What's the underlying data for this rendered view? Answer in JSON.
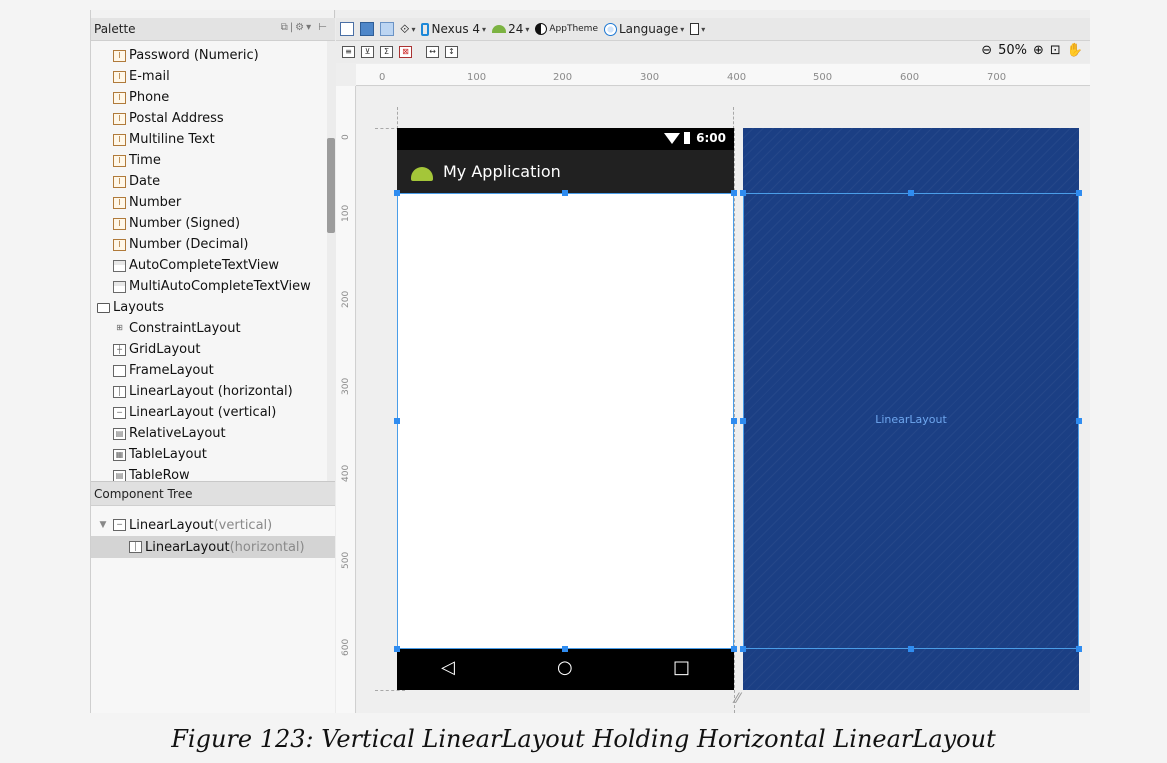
{
  "palette": {
    "title": "Palette",
    "items": [
      {
        "label": "Password (Numeric)",
        "icon": "text-field-icon"
      },
      {
        "label": "E-mail",
        "icon": "text-field-icon"
      },
      {
        "label": "Phone",
        "icon": "text-field-icon"
      },
      {
        "label": "Postal Address",
        "icon": "text-field-icon"
      },
      {
        "label": "Multiline Text",
        "icon": "text-field-icon"
      },
      {
        "label": "Time",
        "icon": "text-field-icon"
      },
      {
        "label": "Date",
        "icon": "text-field-icon"
      },
      {
        "label": "Number",
        "icon": "text-field-icon"
      },
      {
        "label": "Number (Signed)",
        "icon": "text-field-icon"
      },
      {
        "label": "Number (Decimal)",
        "icon": "text-field-icon"
      },
      {
        "label": "AutoCompleteTextView",
        "icon": "autocomplete-icon"
      },
      {
        "label": "MultiAutoCompleteTextView",
        "icon": "autocomplete-icon"
      },
      {
        "label": "Layouts",
        "icon": "folder-icon"
      },
      {
        "label": "ConstraintLayout",
        "icon": "constraint-layout-icon"
      },
      {
        "label": "GridLayout",
        "icon": "grid-layout-icon"
      },
      {
        "label": "FrameLayout",
        "icon": "frame-layout-icon"
      },
      {
        "label": "LinearLayout (horizontal)",
        "icon": "linear-horizontal-icon"
      },
      {
        "label": "LinearLayout (vertical)",
        "icon": "linear-vertical-icon"
      },
      {
        "label": "RelativeLayout",
        "icon": "relative-layout-icon"
      },
      {
        "label": "TableLayout",
        "icon": "table-layout-icon"
      },
      {
        "label": "TableRow",
        "icon": "table-row-icon"
      }
    ]
  },
  "component_tree": {
    "title": "Component Tree",
    "nodes": [
      {
        "label": "LinearLayout",
        "qualifier": "(vertical)"
      },
      {
        "label": "LinearLayout",
        "qualifier": "(horizontal)"
      }
    ]
  },
  "toolbar": {
    "device": "Nexus 4",
    "api": "24",
    "theme": "AppTheme",
    "language": "Language",
    "zoom": "50%"
  },
  "rulers": {
    "top": [
      "0",
      "100",
      "200",
      "300",
      "400",
      "500",
      "600",
      "700"
    ],
    "left": [
      "0",
      "100",
      "200",
      "300",
      "400",
      "500",
      "600"
    ]
  },
  "preview": {
    "time": "6:00",
    "app_title": "My Application",
    "nav": {
      "back": "◁",
      "home": "○",
      "recents": "□"
    }
  },
  "blueprint": {
    "label": "LinearLayout",
    "background_color": "#1b3f84"
  },
  "caption": "Figure 123: Vertical LinearLayout Holding Horizontal LinearLayout"
}
